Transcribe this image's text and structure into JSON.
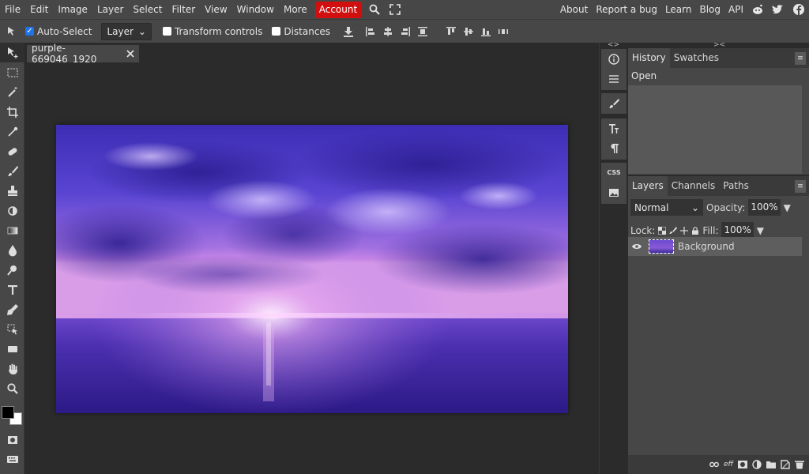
{
  "menu": {
    "items": [
      "File",
      "Edit",
      "Image",
      "Layer",
      "Select",
      "Filter",
      "View",
      "Window",
      "More"
    ],
    "account": "Account",
    "right_links": [
      "About",
      "Report a bug",
      "Learn",
      "Blog",
      "API"
    ]
  },
  "options": {
    "auto_select": "Auto-Select",
    "target_select": "Layer",
    "transform_controls": "Transform controls",
    "distances": "Distances"
  },
  "document": {
    "tab_title": "purple-669046_1920"
  },
  "history": {
    "tabs": [
      "History",
      "Swatches"
    ],
    "items": [
      "Open"
    ]
  },
  "layers": {
    "tabs": [
      "Layers",
      "Channels",
      "Paths"
    ],
    "blend_mode": "Normal",
    "opacity_label": "Opacity:",
    "opacity_value": "100%",
    "lock_label": "Lock:",
    "fill_label": "Fill:",
    "fill_value": "100%",
    "items": [
      {
        "name": "Background"
      }
    ]
  },
  "minibar": {
    "css_label": "CSS"
  },
  "colors": {
    "accent": "#d10f0f",
    "checkbox": "#1e73e8",
    "foreground": "#000000",
    "background": "#ffffff"
  }
}
